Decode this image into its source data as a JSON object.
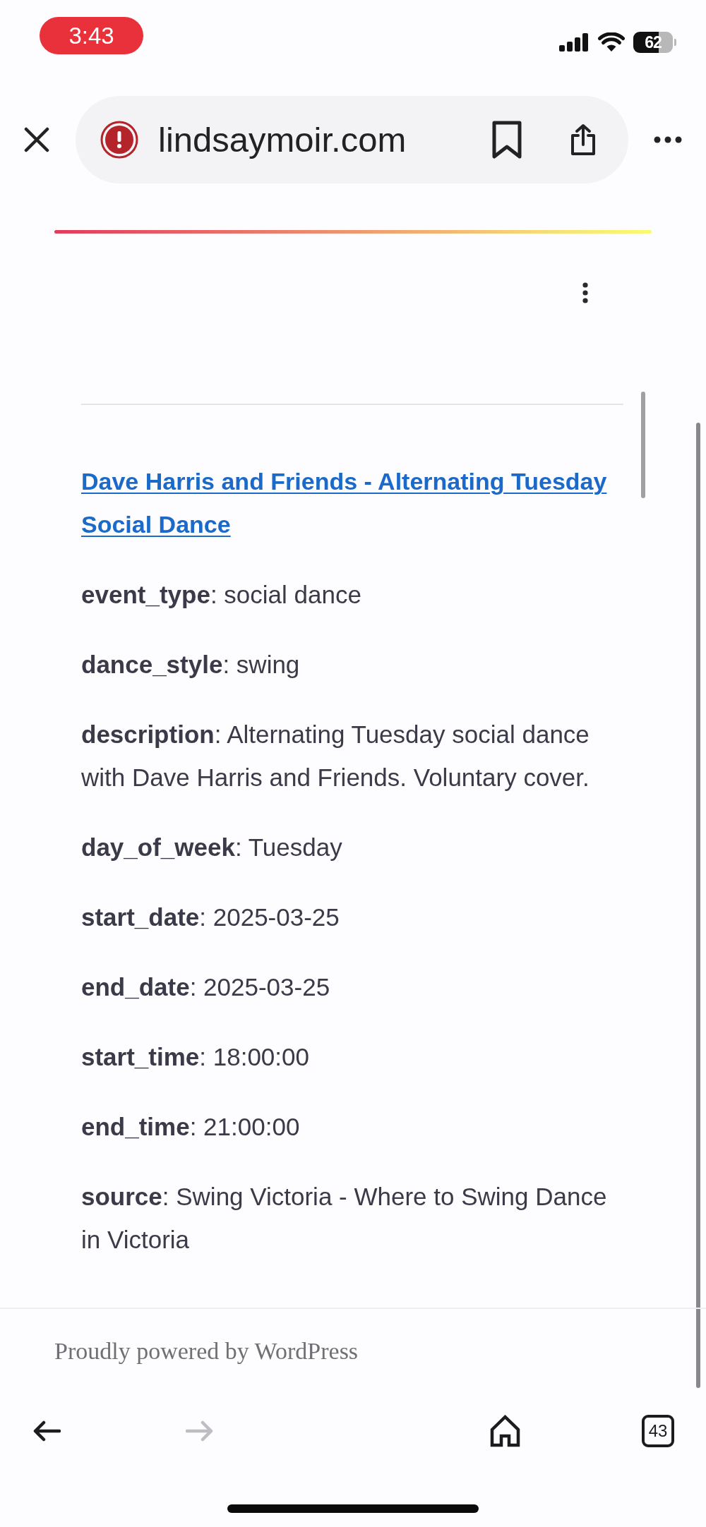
{
  "status_bar": {
    "time": "3:43",
    "battery": "62"
  },
  "browser_toolbar": {
    "url": "lindsaymoir.com"
  },
  "post": {
    "title": "Dave Harris and Friends - Alternating Tuesday Social Dance",
    "fields": [
      "**event_type**: social dance",
      "**dance_style**: swing",
      "**description**: Alternating Tuesday social dance with Dave Harris and Friends. Voluntary cover.",
      "**day_of_week**: Tuesday",
      "**start_date**: 2025-03-25",
      "**end_date**: 2025-03-25",
      "**start_time**: 18:00:00",
      "**end_time**: 21:00:00",
      "**source**: Swing Victoria - Where to Swing Dance in Victoria"
    ]
  },
  "footer": {
    "credit": "Proudly powered by WordPress"
  },
  "bottom_toolbar": {
    "buttons": [
      {
        "kind": "back",
        "disabled": false
      },
      {
        "kind": "forward",
        "disabled": true
      },
      {
        "kind": "home",
        "disabled": false
      },
      {
        "kind": "tabs",
        "disabled": false,
        "count": "43"
      }
    ]
  }
}
